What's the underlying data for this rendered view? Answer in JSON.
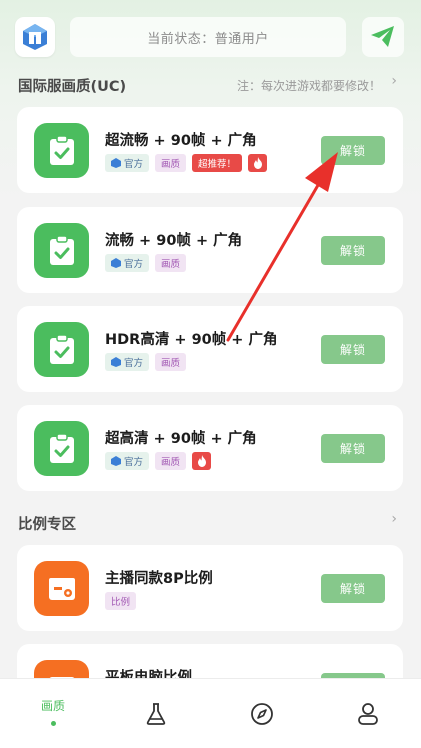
{
  "header": {
    "status_text": "当前状态：普通用户",
    "logo_icon": "app-logo-icon",
    "send_icon": "paper-plane-icon"
  },
  "sections": [
    {
      "title": "国际服画质(UC)",
      "note": "注：每次进游戏都要修改！",
      "chevron": "›"
    },
    {
      "title": "比例专区",
      "chevron": "›"
    }
  ],
  "cards": [
    {
      "title": "超流畅 + 90帧 + 广角",
      "icon": "clipboard-check-icon",
      "tags": {
        "official": "官方",
        "quality": "画质",
        "recommend": "超推荐！"
      },
      "has_fire": true,
      "button": "解锁"
    },
    {
      "title": "流畅 + 90帧 + 广角",
      "icon": "clipboard-check-icon",
      "tags": {
        "official": "官方",
        "quality": "画质"
      },
      "has_fire": false,
      "button": "解锁"
    },
    {
      "title": "HDR高清 + 90帧 + 广角",
      "icon": "clipboard-check-icon",
      "tags": {
        "official": "官方",
        "quality": "画质"
      },
      "has_fire": false,
      "button": "解锁"
    },
    {
      "title": "超高清 + 90帧 + 广角",
      "icon": "clipboard-check-icon",
      "tags": {
        "official": "官方",
        "quality": "画质"
      },
      "has_fire": true,
      "button": "解锁"
    },
    {
      "title": "主播同款8P比例",
      "icon": "calendar-gear-icon",
      "tags": {
        "ratio": "比例"
      },
      "button": "解锁"
    },
    {
      "title": "平板电脑比例",
      "icon": "calendar-gear-icon"
    }
  ],
  "bottom_nav": [
    {
      "label": "画质",
      "icon": "quality-tab",
      "active": true
    },
    {
      "icon": "flask-icon"
    },
    {
      "icon": "compass-icon"
    },
    {
      "icon": "user-icon"
    }
  ],
  "colors": {
    "accent_green": "#4bbd5e",
    "button_green": "#86c88b",
    "orange": "#f56f22",
    "recommend_red": "#e84a47",
    "annotation_arrow": "#e8302b"
  }
}
